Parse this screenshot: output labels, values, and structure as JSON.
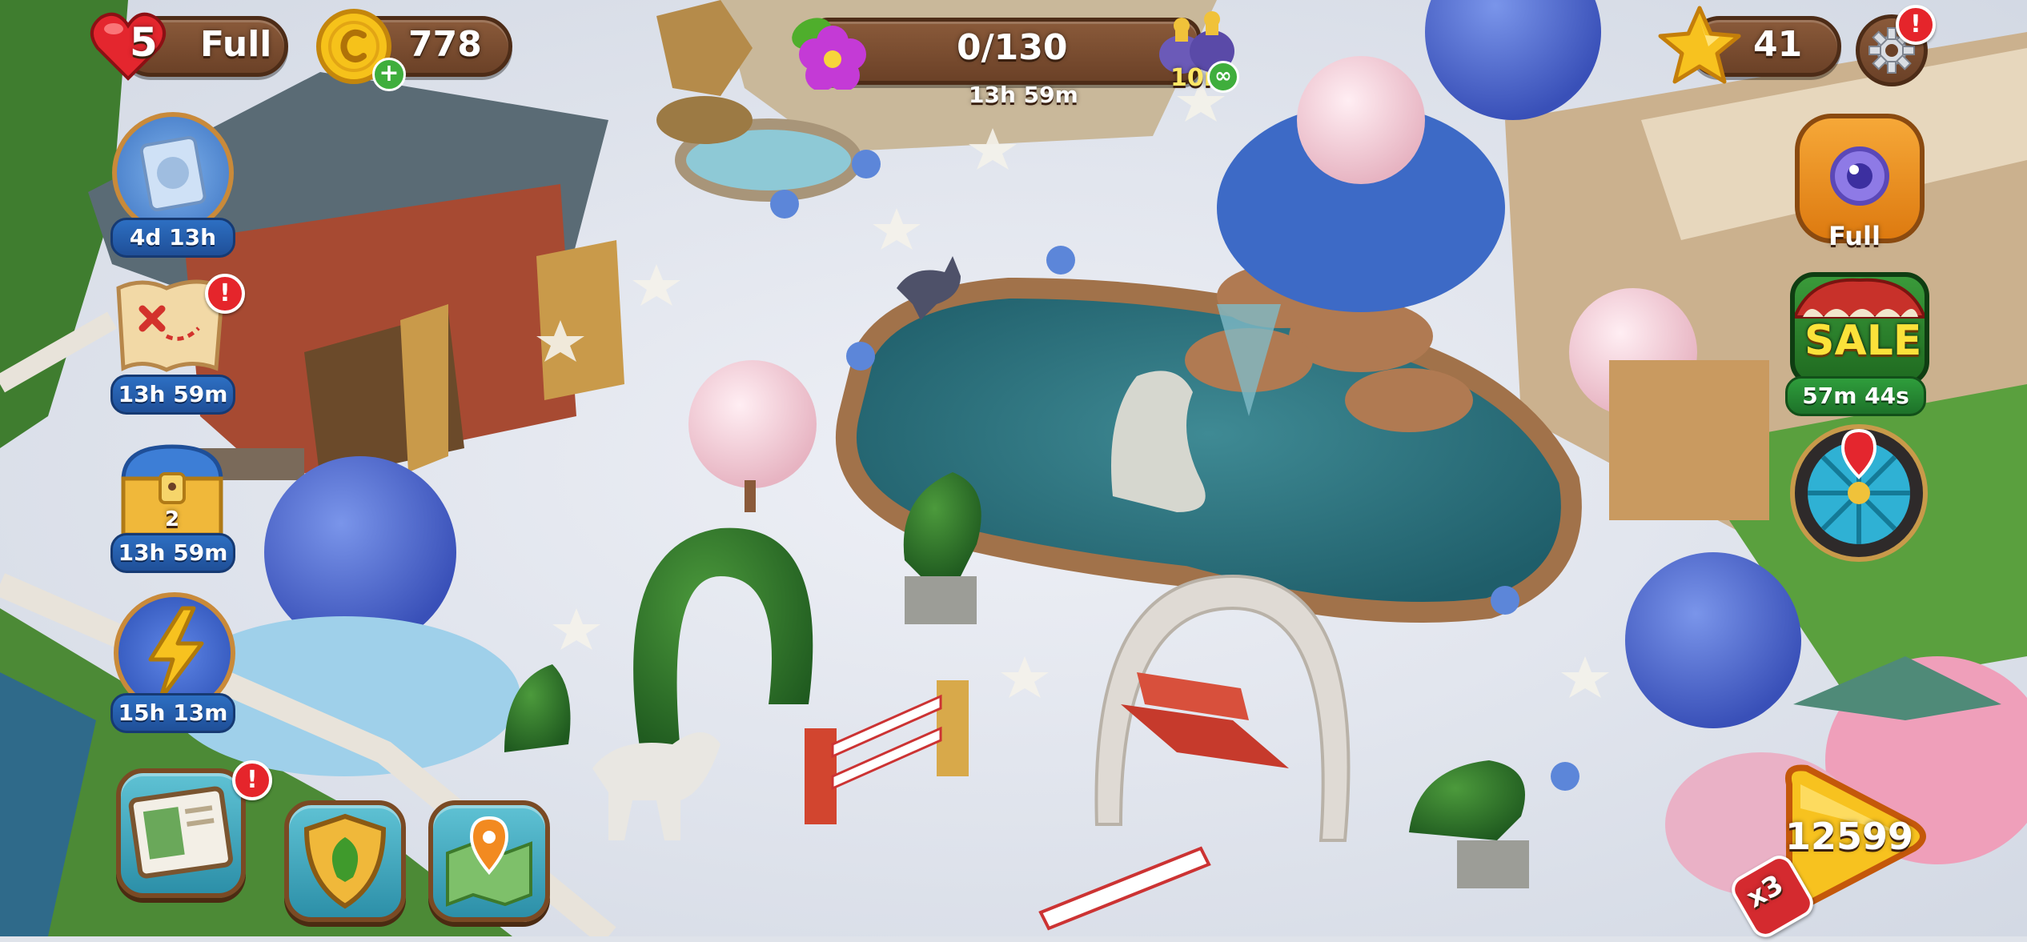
{
  "hud": {
    "lives_count": "5",
    "lives_status": "Full",
    "coins": "778",
    "progress": "0/130",
    "progress_fraction": 0,
    "progress_timer": "13h 59m",
    "booster_time": "10m",
    "stars": "41"
  },
  "left_panel": {
    "event_timer": "4d 13h",
    "map_timer": "13h 59m",
    "chest_count": "2",
    "chest_timer": "13h 59m",
    "lightning_timer": "15h 13m"
  },
  "right_panel": {
    "shop_status": "Full",
    "sale_label": "SALE",
    "sale_timer": "57m 44s"
  },
  "play": {
    "level": "12599",
    "multiplier": "x3"
  },
  "notification_mark": "!",
  "icons": [
    "heart-icon",
    "coin-icon",
    "plus-icon",
    "flower-icon",
    "booster-icon",
    "infinity-icon",
    "star-icon",
    "gear-icon",
    "event-ticket-icon",
    "treasure-map-icon",
    "treasure-chest-icon",
    "lightning-icon",
    "magic-orb-icon",
    "sale-shop-icon",
    "wheel-icon",
    "journal-icon",
    "leaf-shield-icon",
    "map-pin-icon"
  ],
  "colors": {
    "accent_red": "#e5252b",
    "hud_brown": "#7a4b2c",
    "timer_blue": "#1f4f98",
    "timer_green": "#1d7229",
    "play_yellow": "#f6c21a"
  }
}
